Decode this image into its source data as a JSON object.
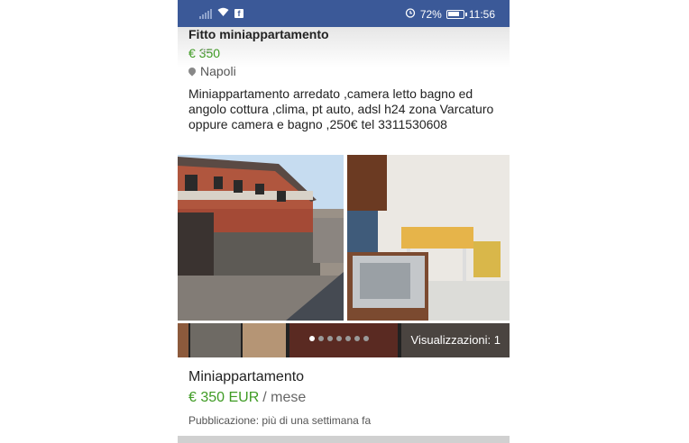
{
  "status_bar": {
    "battery_percent": "72%",
    "time": "11:56",
    "icons": [
      "signal-icon",
      "wifi-icon",
      "facebook-icon",
      "alarm-icon",
      "battery-icon"
    ]
  },
  "listing": {
    "title": "Fitto miniappartamento",
    "price": "€ 350",
    "location": "Napoli",
    "description": "Miniappartamento arredato ,camera letto bagno ed angolo cottura ,clima, pt auto, adsl h24 zona Varcaturo oppure camera e bagno ,250€ tel 3311530608"
  },
  "gallery": {
    "views": "Visualizzazioni: 1",
    "dot_count": 7,
    "active_dot": 0
  },
  "card": {
    "title": "Miniappartamento",
    "price": "€ 350 EUR",
    "period": "/ mese",
    "published": "Pubblicazione: più di una settimana fa"
  },
  "colors": {
    "status_bar": "#3b5998",
    "price": "#3f9b24"
  }
}
